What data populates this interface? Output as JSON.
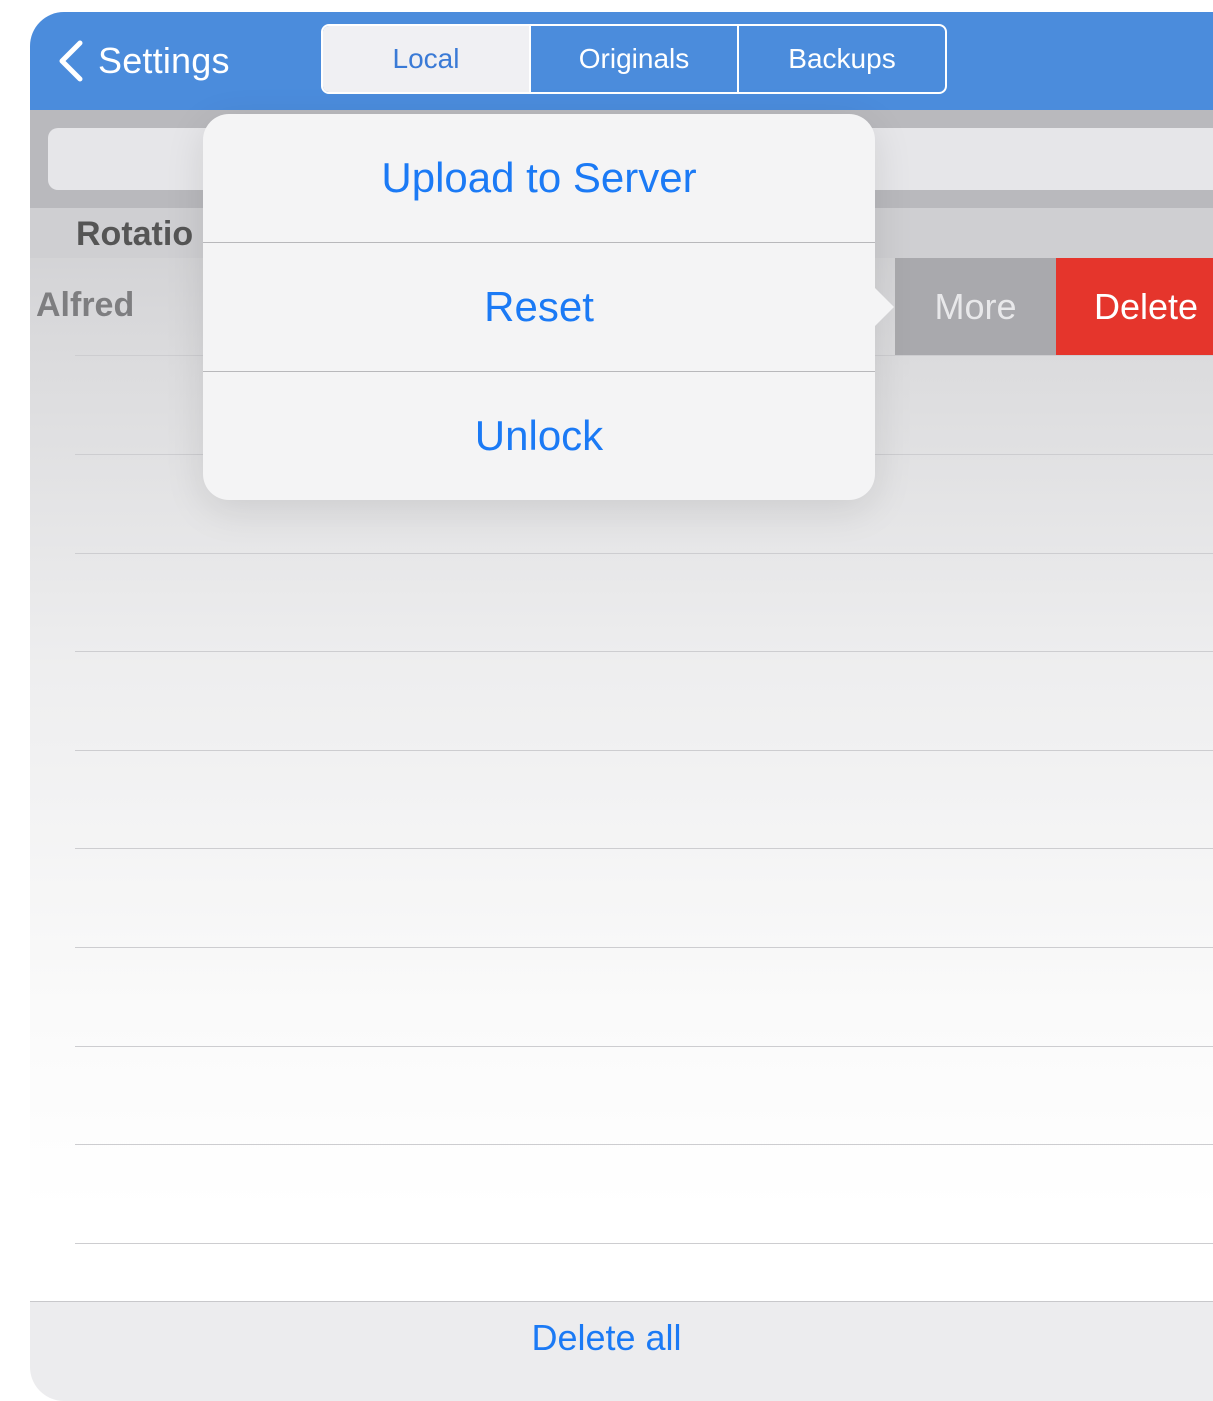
{
  "navbar": {
    "back_label": "Settings",
    "tabs": [
      {
        "label": "Local",
        "selected": true
      },
      {
        "label": "Originals",
        "selected": false
      },
      {
        "label": "Backups",
        "selected": false
      }
    ],
    "color": "#4b8cdc"
  },
  "list": {
    "section_title": "Rotatio",
    "rows": [
      {
        "label": "Alfred"
      }
    ],
    "swipe_actions": {
      "more_label": "More",
      "delete_label": "Delete"
    }
  },
  "popover": {
    "items": [
      {
        "label": "Upload to Server"
      },
      {
        "label": "Reset"
      },
      {
        "label": "Unlock"
      }
    ]
  },
  "toolbar": {
    "delete_all_label": "Delete all"
  },
  "colors": {
    "accent": "#1b7af5",
    "destructive": "#e5352c"
  }
}
